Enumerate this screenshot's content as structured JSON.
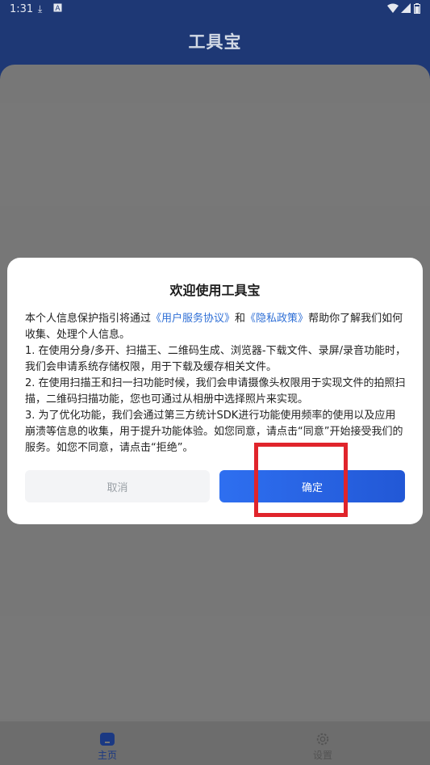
{
  "status_bar": {
    "time": "1:31",
    "icons": [
      "download-icon",
      "a-badge-icon",
      "wifi-icon",
      "signal-icon",
      "battery-icon"
    ]
  },
  "app": {
    "title": "工具宝",
    "nav": {
      "home_label": "主页",
      "settings_label": "设置"
    }
  },
  "dialog": {
    "title": "欢迎使用工具宝",
    "intro_prefix": "本个人信息保护指引将通过",
    "user_agreement_link": "《用户服务协议》",
    "and_text": "和",
    "privacy_link": "《隐私政策》",
    "intro_suffix": "帮助你了解我们如何收集、处理个人信息。",
    "items": [
      "1. 在使用分身/多开、扫描王、二维码生成、浏览器-下载文件、录屏/录音功能时，我们会申请系统存储权限，用于下载及缓存相关文件。",
      "2. 在使用扫描王和扫一扫功能时候，我们会申请摄像头权限用于实现文件的拍照扫描，二维码扫描功能，您也可通过从相册中选择照片来实现。",
      "3. 为了优化功能，我们会通过第三方统计SDK进行功能使用频率的使用以及应用崩溃等信息的收集，用于提升功能体验。如您同意，请点击“同意”开始接受我们的服务。如您不同意，请点击“拒绝”。"
    ],
    "cancel_label": "取消",
    "confirm_label": "确定"
  },
  "colors": {
    "header_bg": "#1f3a78",
    "link": "#2f6fd6",
    "confirm_btn": "#2e6ff0",
    "highlight": "#e0242b"
  }
}
